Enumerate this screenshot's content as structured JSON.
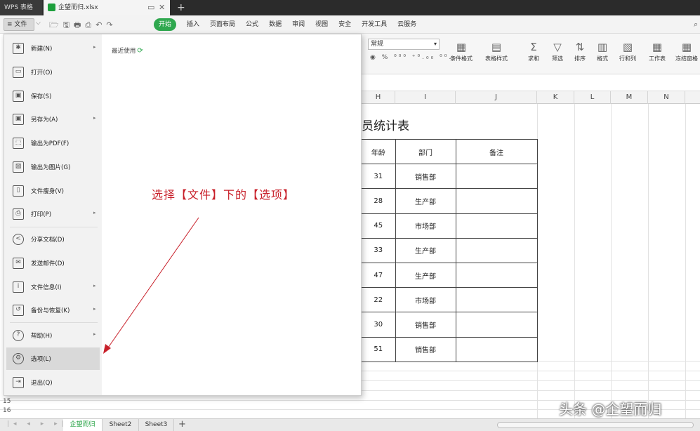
{
  "titlebar": {
    "app_tab": "WPS 表格",
    "doc_tab": "企望而归.xlsx",
    "pin_icon": "▭",
    "close_icon": "✕",
    "new_tab_icon": "+"
  },
  "menubar": {
    "file_label": "≡ 文件",
    "file_dropdown": "⌵",
    "quick_icons": "🗁🖫🖶⎙↶↷",
    "tabs": [
      "开始",
      "插入",
      "页面布局",
      "公式",
      "数据",
      "审阅",
      "视图",
      "安全",
      "开发工具",
      "云服务"
    ],
    "search_icon": "⌕"
  },
  "ribbon": {
    "number_format": "常规",
    "number_format_caret": "▾",
    "number_row": "◉ % ⁰⁰⁰ ⁺⁰.₀₀ ⁰⁰.₀",
    "buttons": [
      {
        "label": "条件格式",
        "icon": "▦"
      },
      {
        "label": "表格样式",
        "icon": "▤"
      },
      {
        "label": "求和",
        "icon": "Σ"
      },
      {
        "label": "筛选",
        "icon": "▽"
      },
      {
        "label": "排序",
        "icon": "⇅"
      },
      {
        "label": "格式",
        "icon": "▥"
      },
      {
        "label": "行和列",
        "icon": "▧"
      },
      {
        "label": "工作表",
        "icon": "▦"
      },
      {
        "label": "冻结窗格",
        "icon": "▦"
      }
    ]
  },
  "grid": {
    "columns": [
      "H",
      "I",
      "J",
      "K",
      "L",
      "M",
      "N"
    ],
    "title_partial": "员统计表",
    "table_header": [
      "年龄",
      "部门",
      "备注"
    ],
    "rows": [
      {
        "age": "31",
        "dept": "销售部",
        "note": ""
      },
      {
        "age": "28",
        "dept": "生产部",
        "note": ""
      },
      {
        "age": "45",
        "dept": "市场部",
        "note": ""
      },
      {
        "age": "33",
        "dept": "生产部",
        "note": ""
      },
      {
        "age": "47",
        "dept": "生产部",
        "note": ""
      },
      {
        "age": "22",
        "dept": "市场部",
        "note": ""
      },
      {
        "age": "30",
        "dept": "销售部",
        "note": ""
      },
      {
        "age": "51",
        "dept": "销售部",
        "note": ""
      }
    ],
    "row_numbers": [
      "15",
      "16"
    ]
  },
  "sheets": {
    "nav": "|◂ ◂ ▸ ▸|",
    "tabs": [
      "企望而归",
      "Sheet2",
      "Sheet3"
    ],
    "add_icon": "+"
  },
  "file_menu": {
    "recent_label": "最近使用",
    "recent_icon": "⟳",
    "items": [
      {
        "label": "新建(N)",
        "icon": "new-doc",
        "glyph": "✱"
      },
      {
        "label": "打开(O)",
        "icon": "folder",
        "glyph": "▭"
      },
      {
        "label": "保存(S)",
        "icon": "save",
        "glyph": "▣"
      },
      {
        "label": "另存为(A)",
        "icon": "save-as",
        "glyph": "▣"
      },
      {
        "label": "输出为PDF(F)",
        "icon": "pdf",
        "glyph": "⬚"
      },
      {
        "label": "输出为图片(G)",
        "icon": "image",
        "glyph": "▨"
      },
      {
        "label": "文件瘦身(V)",
        "icon": "slim",
        "glyph": "▯"
      },
      {
        "label": "打印(P)",
        "icon": "print",
        "glyph": "⎙"
      },
      {
        "label": "分享文档(D)",
        "icon": "share",
        "glyph": "<"
      },
      {
        "label": "发送邮件(D)",
        "icon": "mail",
        "glyph": "✉"
      },
      {
        "label": "文件信息(I)",
        "icon": "info",
        "glyph": "i"
      },
      {
        "label": "备份与恢复(K)",
        "icon": "backup",
        "glyph": "↺"
      },
      {
        "label": "帮助(H)",
        "icon": "help",
        "glyph": "?"
      },
      {
        "label": "选项(L)",
        "icon": "gear",
        "glyph": "⚙"
      },
      {
        "label": "退出(Q)",
        "icon": "exit",
        "glyph": "⇥"
      }
    ],
    "submenu_arrow": "▸"
  },
  "annotation": {
    "text": "选择【文件】下的【选项】",
    "color": "#c8202a"
  },
  "watermark": "头条 @企望而归"
}
